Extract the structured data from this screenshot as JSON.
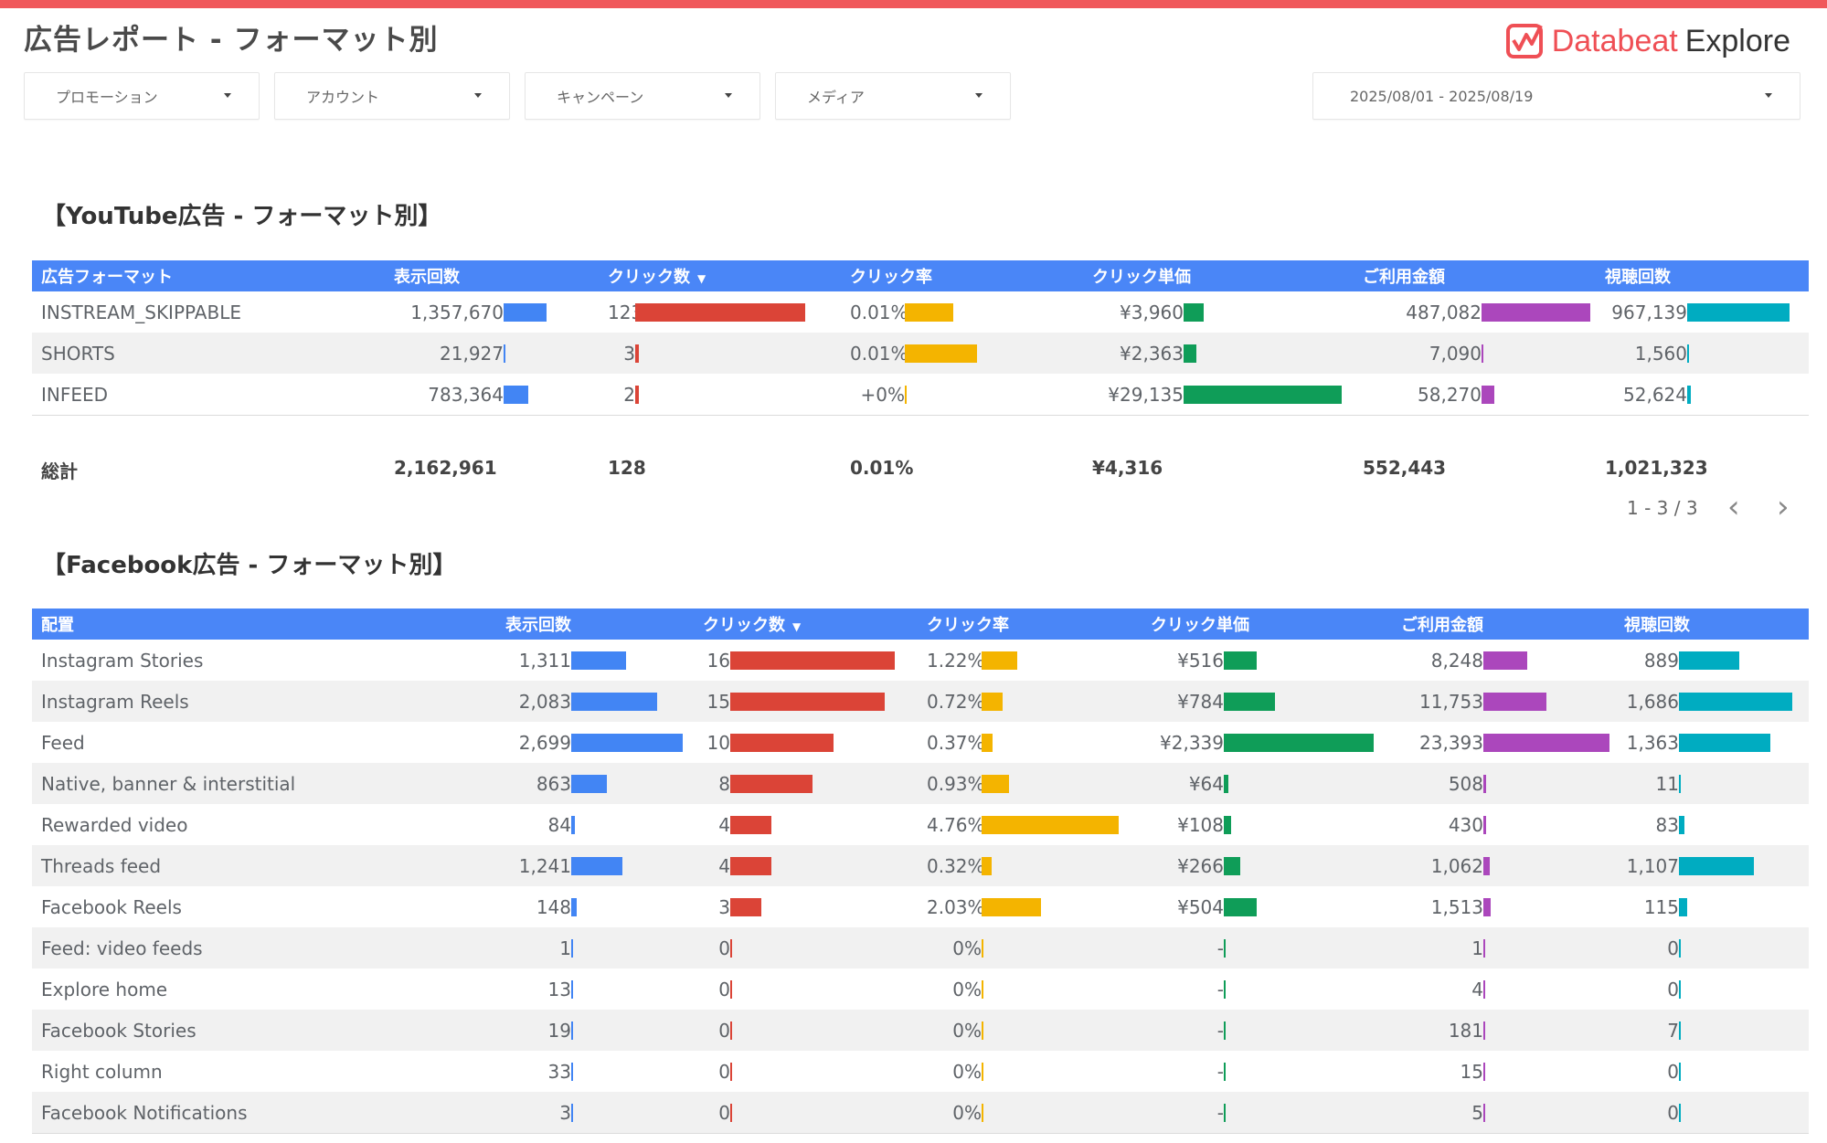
{
  "header": {
    "title": "広告レポート - フォーマット別",
    "brand_name": "Databeat",
    "brand_suffix": "Explore",
    "accent_color": "#f0585b"
  },
  "filters": [
    {
      "label": "プロモーション"
    },
    {
      "label": "アカウント"
    },
    {
      "label": "キャンペーン"
    },
    {
      "label": "メディア"
    },
    {
      "label": "2025/08/01 - 2025/08/19"
    }
  ],
  "youtube": {
    "title": "【YouTube広告 - フォーマット別】",
    "columns": [
      "広告フォーマット",
      "表示回数",
      "クリック数",
      "クリック率",
      "クリック単価",
      "ご利用金額",
      "視聴回数"
    ],
    "sort_indicator": "▼",
    "rows": [
      {
        "name": "INSTREAM_SKIPPABLE",
        "impressions": "1,357,670",
        "clicks": "123",
        "ctr": "0.01%",
        "cpc": "¥3,960",
        "cost": "487,082",
        "views": "967,139",
        "bars": [
          0.57,
          1.0,
          0.47,
          0.13,
          0.84,
          1.0
        ]
      },
      {
        "name": "SHORTS",
        "impressions": "21,927",
        "clicks": "3",
        "ctr": "0.01%",
        "cpc": "¥2,363",
        "cost": "7,090",
        "views": "1,560",
        "bars": [
          0.01,
          0.02,
          0.7,
          0.08,
          0.01,
          0.0
        ]
      },
      {
        "name": "INFEED",
        "impressions": "783,364",
        "clicks": "2",
        "ctr": "+0%",
        "cpc": "¥29,135",
        "cost": "58,270",
        "views": "52,624",
        "bars": [
          0.33,
          0.02,
          0.01,
          1.0,
          0.1,
          0.04
        ]
      }
    ],
    "totals": {
      "label": "総計",
      "impressions": "2,162,961",
      "clicks": "128",
      "ctr": "0.01%",
      "cpc": "¥4,316",
      "cost": "552,443",
      "views": "1,021,323"
    },
    "pager": "1 - 3 / 3"
  },
  "facebook": {
    "title": "【Facebook広告 - フォーマット別】",
    "columns": [
      "配置",
      "表示回数",
      "クリック数",
      "クリック率",
      "クリック単価",
      "ご利用金額",
      "視聴回数"
    ],
    "sort_indicator": "▼",
    "rows": [
      {
        "name": "Instagram Stories",
        "impressions": "1,311",
        "clicks": "16",
        "ctr": "1.22%",
        "cpc": "¥516",
        "cost": "8,248",
        "views": "889",
        "bars": [
          0.49,
          1.0,
          0.26,
          0.22,
          0.35,
          0.53
        ]
      },
      {
        "name": "Instagram Reels",
        "impressions": "2,083",
        "clicks": "15",
        "ctr": "0.72%",
        "cpc": "¥784",
        "cost": "11,753",
        "views": "1,686",
        "bars": [
          0.77,
          0.94,
          0.15,
          0.34,
          0.5,
          1.0
        ]
      },
      {
        "name": "Feed",
        "impressions": "2,699",
        "clicks": "10",
        "ctr": "0.37%",
        "cpc": "¥2,339",
        "cost": "23,393",
        "views": "1,363",
        "bars": [
          1.0,
          0.63,
          0.08,
          1.0,
          1.0,
          0.81
        ]
      },
      {
        "name": "Native, banner & interstitial",
        "impressions": "863",
        "clicks": "8",
        "ctr": "0.93%",
        "cpc": "¥64",
        "cost": "508",
        "views": "11",
        "bars": [
          0.32,
          0.5,
          0.2,
          0.03,
          0.02,
          0.01
        ]
      },
      {
        "name": "Rewarded video",
        "impressions": "84",
        "clicks": "4",
        "ctr": "4.76%",
        "cpc": "¥108",
        "cost": "430",
        "views": "83",
        "bars": [
          0.03,
          0.25,
          1.0,
          0.05,
          0.02,
          0.05
        ]
      },
      {
        "name": "Threads feed",
        "impressions": "1,241",
        "clicks": "4",
        "ctr": "0.32%",
        "cpc": "¥266",
        "cost": "1,062",
        "views": "1,107",
        "bars": [
          0.46,
          0.25,
          0.07,
          0.11,
          0.05,
          0.66
        ]
      },
      {
        "name": "Facebook Reels",
        "impressions": "148",
        "clicks": "3",
        "ctr": "2.03%",
        "cpc": "¥504",
        "cost": "1,513",
        "views": "115",
        "bars": [
          0.05,
          0.19,
          0.43,
          0.22,
          0.06,
          0.07
        ]
      },
      {
        "name": "Feed: video feeds",
        "impressions": "1",
        "clicks": "0",
        "ctr": "0%",
        "cpc": "-",
        "cost": "1",
        "views": "0",
        "bars": [
          0,
          0,
          0,
          0,
          0,
          0
        ]
      },
      {
        "name": "Explore home",
        "impressions": "13",
        "clicks": "0",
        "ctr": "0%",
        "cpc": "-",
        "cost": "4",
        "views": "0",
        "bars": [
          0,
          0,
          0,
          0,
          0,
          0
        ]
      },
      {
        "name": "Facebook Stories",
        "impressions": "19",
        "clicks": "0",
        "ctr": "0%",
        "cpc": "-",
        "cost": "181",
        "views": "7",
        "bars": [
          0,
          0,
          0,
          0,
          0,
          0
        ]
      },
      {
        "name": "Right column",
        "impressions": "33",
        "clicks": "0",
        "ctr": "0%",
        "cpc": "-",
        "cost": "15",
        "views": "0",
        "bars": [
          0,
          0,
          0,
          0,
          0,
          0
        ]
      },
      {
        "name": "Facebook Notifications",
        "impressions": "3",
        "clicks": "0",
        "ctr": "0%",
        "cpc": "-",
        "cost": "5",
        "views": "0",
        "bars": [
          0,
          0,
          0,
          0,
          0,
          0
        ]
      }
    ]
  },
  "bar_colors": [
    "#4285f4",
    "#db4437",
    "#f4b400",
    "#0f9d58",
    "#ab47bc",
    "#00acc1"
  ]
}
